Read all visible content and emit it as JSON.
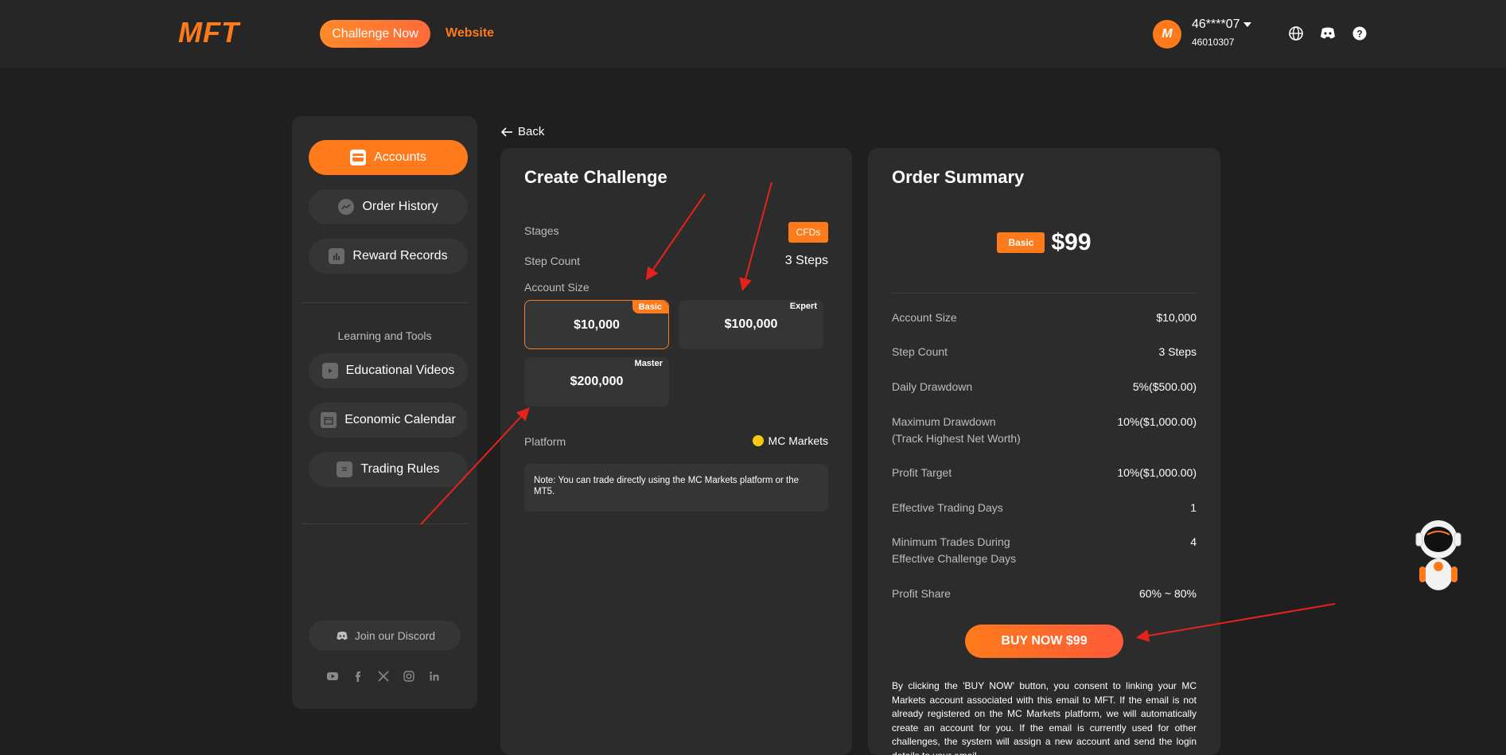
{
  "header": {
    "logo": "MFT",
    "challenge_btn": "Challenge Now",
    "website_link": "Website",
    "avatar_letter": "M",
    "user_name": "46****07",
    "user_id": "46010307"
  },
  "sidebar": {
    "items": [
      {
        "label": "Accounts",
        "icon": "card-icon"
      },
      {
        "label": "Order History",
        "icon": "chart-icon"
      },
      {
        "label": "Reward Records",
        "icon": "bars-icon"
      }
    ],
    "section_title": "Learning and Tools",
    "tools": [
      {
        "label": "Educational Videos",
        "icon": "play-icon"
      },
      {
        "label": "Economic Calendar",
        "icon": "calendar-icon"
      },
      {
        "label": "Trading Rules",
        "icon": "doc-icon"
      }
    ],
    "discord_label": "Join our Discord",
    "socials": [
      "youtube-icon",
      "facebook-icon",
      "x-icon",
      "instagram-icon",
      "linkedin-icon"
    ]
  },
  "back_label": "Back",
  "create": {
    "title": "Create Challenge",
    "stages_label": "Stages",
    "stages_value": "CFDs",
    "step_count_label": "Step Count",
    "step_count_value": "3 Steps",
    "account_size_label": "Account Size",
    "sizes": [
      {
        "amount": "$10,000",
        "tag": "Basic"
      },
      {
        "amount": "$100,000",
        "tag": "Expert"
      },
      {
        "amount": "$200,000",
        "tag": "Master"
      }
    ],
    "platform_label": "Platform",
    "platform_value": "MC Markets",
    "note": "Note: You can trade directly using the MC Markets platform or the MT5."
  },
  "summary": {
    "title": "Order Summary",
    "tag": "Basic",
    "price": "$99",
    "rows": [
      {
        "label": "Account Size",
        "value": "$10,000"
      },
      {
        "label": "Step Count",
        "value": "3 Steps"
      },
      {
        "label": "Daily Drawdown",
        "value": "5%($500.00)"
      },
      {
        "label": "Maximum Drawdown",
        "label2": "(Track Highest Net Worth)",
        "value": "10%($1,000.00)"
      },
      {
        "label": "Profit Target",
        "value": "10%($1,000.00)"
      },
      {
        "label": "Effective Trading Days",
        "value": "1"
      },
      {
        "label": "Minimum Trades During",
        "label2": "Effective Challenge Days",
        "value": "4"
      },
      {
        "label": "Profit Share",
        "value": "60% ~ 80%"
      }
    ],
    "buy_label": "BUY NOW $99",
    "disclaimer": "By clicking the 'BUY NOW' button, you consent to linking your MC Markets account associated with this email to MFT. If the email is not already registered on the MC Markets platform, we will automatically create an account for you. If the email is currently used for other challenges, the system will assign a new account and send the login details to your email."
  },
  "colors": {
    "accent": "#ff7a1a",
    "background": "#1f1f1f",
    "panel": "#2c2c2c",
    "annotation_arrow": "#e8221b"
  }
}
